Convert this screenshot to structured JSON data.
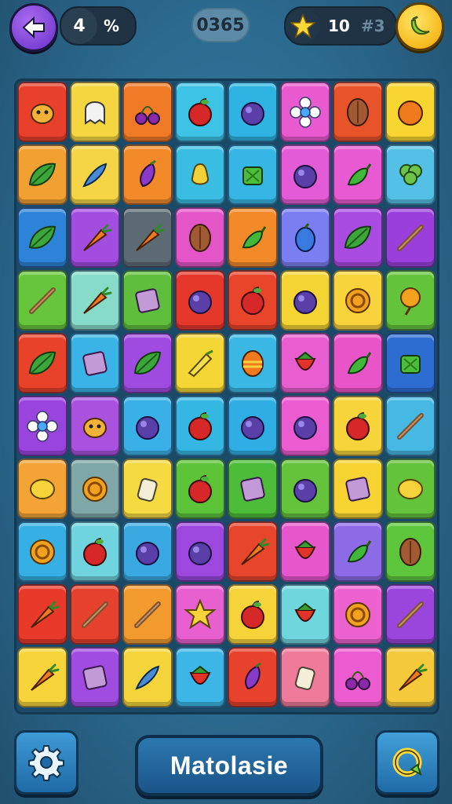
{
  "topbar": {
    "moves": "4",
    "moves_symbol": "%",
    "score": "0365",
    "stars_count": "10",
    "stars_target": "#3"
  },
  "bottom": {
    "title_label": "Matolasie"
  },
  "icons": {
    "back": "arrow-left-icon",
    "star": "star-icon",
    "hint": "banana-icon",
    "settings": "gear-icon",
    "refresh": "refresh-icon"
  },
  "board": {
    "rows": [
      [
        {
          "color": "#e8402a",
          "item": "creature"
        },
        {
          "color": "#f6d640",
          "item": "ghost"
        },
        {
          "color": "#f07a25",
          "item": "cherries"
        },
        {
          "color": "#3dc3e6",
          "item": "apple"
        },
        {
          "color": "#2eb3e2",
          "item": "plum"
        },
        {
          "color": "#e95ad0",
          "item": "flower"
        },
        {
          "color": "#e9532a",
          "item": "seed"
        },
        {
          "color": "#f8d531",
          "item": "orange"
        }
      ],
      [
        {
          "color": "#f3a033",
          "item": "leaf"
        },
        {
          "color": "#f5d545",
          "item": "feather"
        },
        {
          "color": "#f28a2a",
          "item": "eggplant"
        },
        {
          "color": "#39bde3",
          "item": "pear"
        },
        {
          "color": "#35b6e4",
          "item": "greens"
        },
        {
          "color": "#e35bd6",
          "item": "plum"
        },
        {
          "color": "#e85ad1",
          "item": "pepper"
        },
        {
          "color": "#54c0e6",
          "item": "broccoli"
        }
      ],
      [
        {
          "color": "#2d83d8",
          "item": "leaf"
        },
        {
          "color": "#a24ce0",
          "item": "carrot"
        },
        {
          "color": "#5c6a74",
          "item": "carrot"
        },
        {
          "color": "#e455c8",
          "item": "seed"
        },
        {
          "color": "#f28a2a",
          "item": "pepper"
        },
        {
          "color": "#7b7ef0",
          "item": "berry"
        },
        {
          "color": "#a94be1",
          "item": "leaf"
        },
        {
          "color": "#9a3fdc",
          "item": "stick"
        }
      ],
      [
        {
          "color": "#66c53a",
          "item": "stick"
        },
        {
          "color": "#86dcc8",
          "item": "carrot"
        },
        {
          "color": "#5fbf3c",
          "item": "box"
        },
        {
          "color": "#e5382b",
          "item": "plum"
        },
        {
          "color": "#e8452a",
          "item": "apple"
        },
        {
          "color": "#f4d433",
          "item": "plum"
        },
        {
          "color": "#f8d23a",
          "item": "coin"
        },
        {
          "color": "#63c43c",
          "item": "balloon"
        }
      ],
      [
        {
          "color": "#e9422a",
          "item": "leaf"
        },
        {
          "color": "#3ab3e6",
          "item": "box"
        },
        {
          "color": "#a04be0",
          "item": "leaf"
        },
        {
          "color": "#f4d634",
          "item": "corn"
        },
        {
          "color": "#3ab7e5",
          "item": "egg"
        },
        {
          "color": "#e85dcf",
          "item": "strawberry"
        },
        {
          "color": "#e955c9",
          "item": "pepper"
        },
        {
          "color": "#2d6dd2",
          "item": "greens"
        }
      ],
      [
        {
          "color": "#9a44de",
          "item": "flower"
        },
        {
          "color": "#a952df",
          "item": "creature"
        },
        {
          "color": "#39b0e6",
          "item": "plum"
        },
        {
          "color": "#35b7e4",
          "item": "apple"
        },
        {
          "color": "#2eaee3",
          "item": "plum"
        },
        {
          "color": "#ea5cd0",
          "item": "plum"
        },
        {
          "color": "#f6d43a",
          "item": "apple"
        },
        {
          "color": "#45b9e3",
          "item": "stick"
        }
      ],
      [
        {
          "color": "#f4a437",
          "item": "lemon"
        },
        {
          "color": "#7fa7a8",
          "item": "coin"
        },
        {
          "color": "#f6da42",
          "item": "jar"
        },
        {
          "color": "#5dc43a",
          "item": "apple"
        },
        {
          "color": "#4dbd39",
          "item": "box"
        },
        {
          "color": "#64c23b",
          "item": "plum"
        },
        {
          "color": "#f6d330",
          "item": "box"
        },
        {
          "color": "#63c33a",
          "item": "lemon"
        }
      ],
      [
        {
          "color": "#36b0e4",
          "item": "coin"
        },
        {
          "color": "#6fd4de",
          "item": "apple"
        },
        {
          "color": "#3aa8e1",
          "item": "plum"
        },
        {
          "color": "#9c47de",
          "item": "plum"
        },
        {
          "color": "#e7452c",
          "item": "carrot"
        },
        {
          "color": "#e657cd",
          "item": "strawberry"
        },
        {
          "color": "#8d6ae6",
          "item": "pepper"
        },
        {
          "color": "#5ec63d",
          "item": "seed"
        }
      ],
      [
        {
          "color": "#e8392a",
          "item": "carrot"
        },
        {
          "color": "#e6412c",
          "item": "stick"
        },
        {
          "color": "#f39a2e",
          "item": "stick"
        },
        {
          "color": "#e85fd0",
          "item": "star"
        },
        {
          "color": "#f6d339",
          "item": "apple"
        },
        {
          "color": "#6fd6de",
          "item": "strawberry"
        },
        {
          "color": "#ec62cf",
          "item": "coin"
        },
        {
          "color": "#9a45dc",
          "item": "stick"
        }
      ],
      [
        {
          "color": "#f6d43a",
          "item": "carrot"
        },
        {
          "color": "#a14ce0",
          "item": "box"
        },
        {
          "color": "#f4d43a",
          "item": "feather"
        },
        {
          "color": "#3cb6e6",
          "item": "strawberry"
        },
        {
          "color": "#e8412c",
          "item": "eggplant"
        },
        {
          "color": "#ef7a9a",
          "item": "jar"
        },
        {
          "color": "#ec5bd0",
          "item": "cherries"
        },
        {
          "color": "#f4c93a",
          "item": "carrot"
        }
      ]
    ]
  }
}
